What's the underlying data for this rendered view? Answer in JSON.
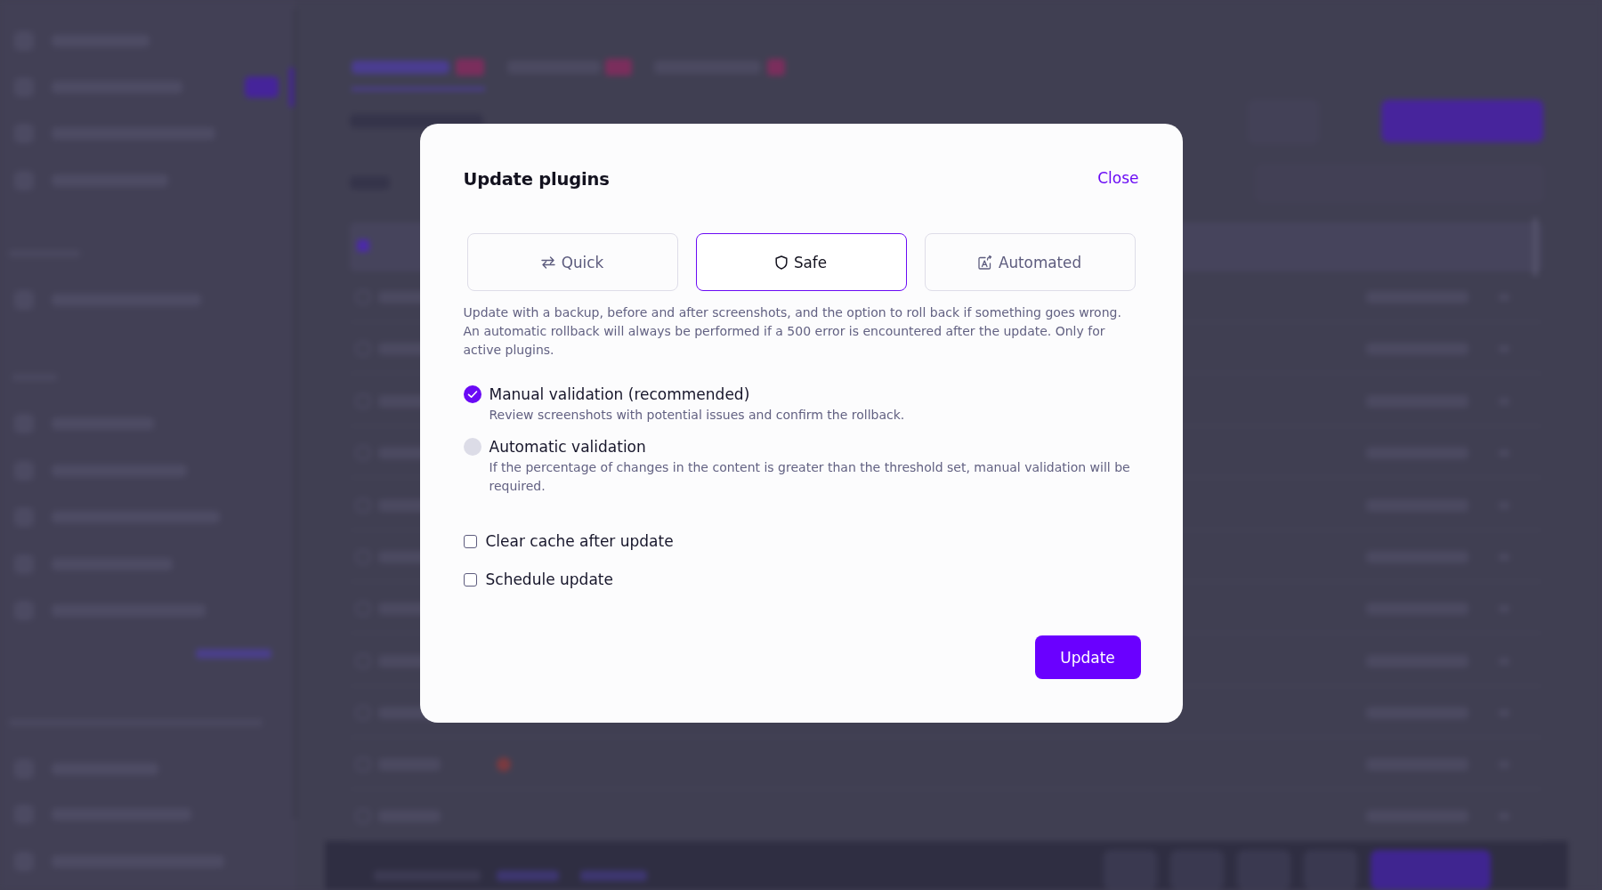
{
  "dialog": {
    "title": "Update plugins",
    "close_label": "Close",
    "modes": [
      {
        "kind": "quick",
        "label": "Quick",
        "selected": false
      },
      {
        "kind": "safe",
        "label": "Safe",
        "selected": true
      },
      {
        "kind": "automated",
        "label": "Automated",
        "selected": false
      }
    ],
    "description": "Update with a backup, before and after screenshots, and the option to roll back if something goes wrong. An automatic rollback will always be performed if a 500 error is encountered after the update. Only for active plugins.",
    "validation_options": [
      {
        "label": "Manual validation (recommended)",
        "description": "Review screenshots with potential issues and confirm the rollback.",
        "selected": true
      },
      {
        "label": "Automatic validation",
        "description": "If the percentage of changes in the content is greater than the threshold set, manual validation will be required.",
        "selected": false
      }
    ],
    "options": [
      {
        "label": "Clear cache after update",
        "checked": false
      },
      {
        "label": "Schedule update",
        "checked": false
      }
    ],
    "submit_label": "Update"
  }
}
